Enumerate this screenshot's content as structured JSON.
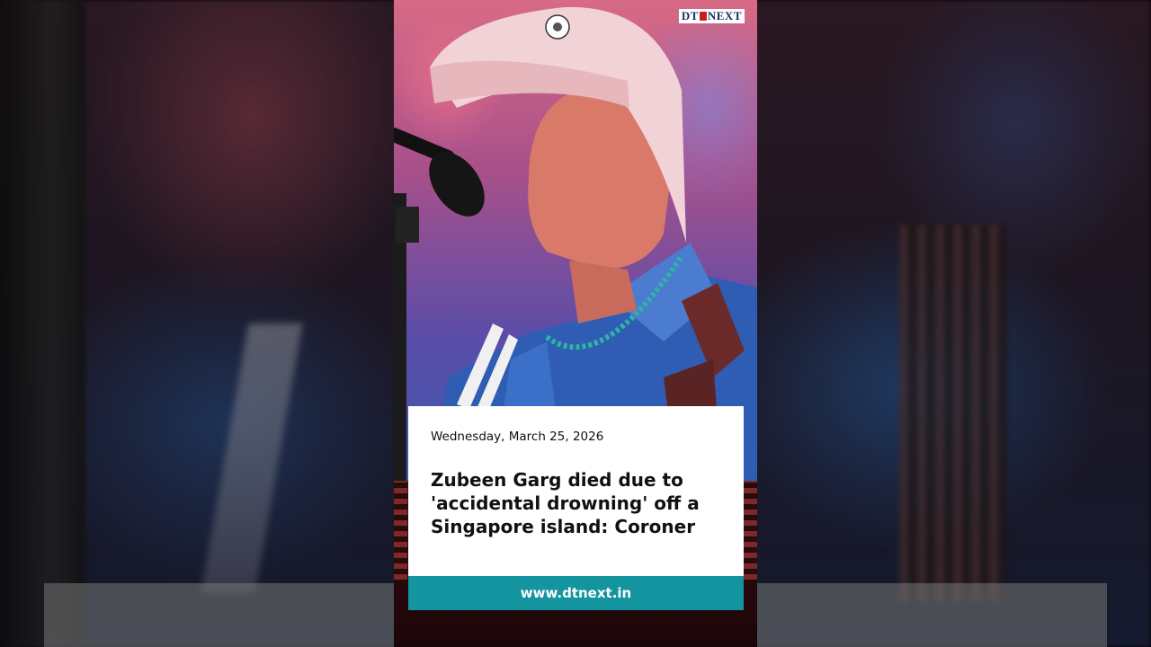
{
  "logo": {
    "text_left": "DT",
    "text_right": "NEXT"
  },
  "article": {
    "date": "Wednesday, March 25, 2026",
    "headline": "Zubeen Garg died due to 'accidental drowning' off a Singapore island: Coroner"
  },
  "source": {
    "url": "www.dtnext.in"
  },
  "colors": {
    "accent": "#13949f",
    "logo_text": "#1b3060",
    "logo_mark": "#c82020",
    "card_bg": "#ffffff"
  },
  "icons": {
    "photo": "performer-photo",
    "logo_mark": "logo-mark-icon"
  }
}
